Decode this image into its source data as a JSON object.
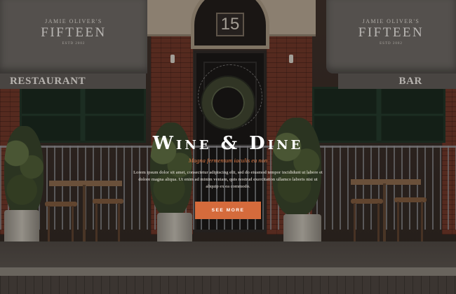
{
  "scene": {
    "left_awning": {
      "top_line": "JAMIE OLIVER'S",
      "brand": "FIFTEEN",
      "small_line": "ESTD 2002",
      "valance": "RESTAURANT"
    },
    "right_awning": {
      "top_line": "JAMIE OLIVER'S",
      "brand": "FIFTEEN",
      "small_line": "ESTD 2002",
      "valance": "BAR"
    },
    "door_number": "15"
  },
  "hero": {
    "heading": "Wine & Dine",
    "subheading": "Magna fermentum iaculis eu non",
    "body": "Lorem ipsum dolor sit amet, consectetur adipiscing elit, sed do eiusmod tempor incididunt ut labore et dolore magna aliqua. Ut enim ad minim veniam, quis nostrud exercitation ullamco laboris nisi ut aliquip ex ea commodo.",
    "button_label": "SEE MORE"
  },
  "colors": {
    "accent": "#d56b3c",
    "subheading": "#e17a45"
  }
}
